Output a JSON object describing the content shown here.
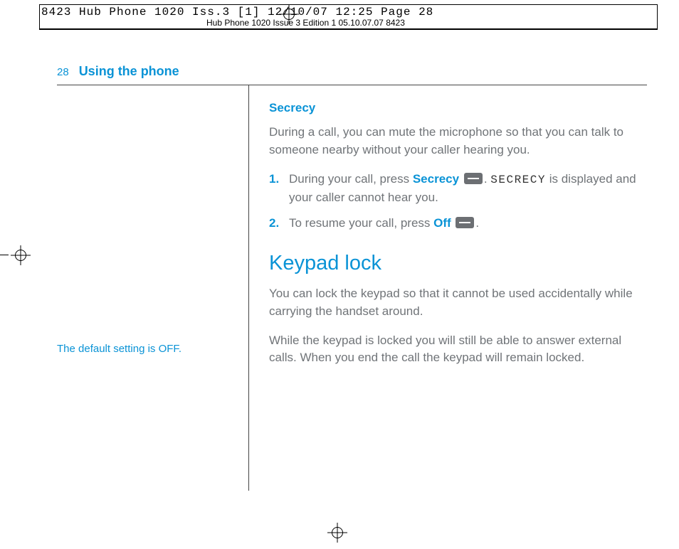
{
  "crop": {
    "status_line": "8423 Hub Phone 1020 Iss.3 [1]  12/10/07  12:25  Page 28",
    "mid_line": "Hub Phone 1020   Issue 3   Edition 1   05.10.07.07   8423"
  },
  "header": {
    "page_number": "28",
    "section": "Using the phone"
  },
  "sidebar": {
    "note": "The default setting is OFF."
  },
  "secrecy": {
    "heading": "Secrecy",
    "intro": "During a call, you can mute the microphone so that you can talk to someone nearby without your caller hearing you.",
    "steps": {
      "n1": "1.",
      "s1a": "During your call, press ",
      "s1_kw": "Secrecy",
      "s1b": ". ",
      "s1_disp": "SECRECY",
      "s1c": " is displayed and your caller cannot hear you.",
      "n2": "2.",
      "s2a": "To resume your call, press ",
      "s2_kw": "Off",
      "s2b": "."
    }
  },
  "keypad": {
    "heading": "Keypad lock",
    "p1": "You can lock the keypad so that it cannot be used accidentally while carrying the handset around.",
    "p2": "While the keypad is locked you will still be able to answer external calls. When you end the call the keypad will remain locked."
  }
}
